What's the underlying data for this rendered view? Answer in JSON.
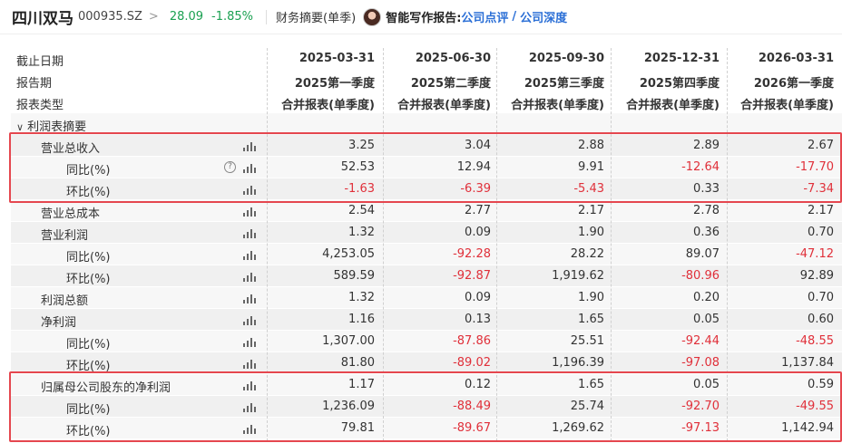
{
  "topbar": {
    "stock_name": "四川双马",
    "stock_code": "000935.SZ",
    "chevron": ">",
    "price": "28.09",
    "change": "-1.85%",
    "summary": "财务摘要(单季)",
    "ai_label": "智能写作报告:",
    "link_review": "公司点评",
    "slash": "/",
    "link_deep": "公司深度"
  },
  "header": {
    "rows": [
      {
        "label": "截止日期",
        "values": [
          "2025-03-31",
          "2025-06-30",
          "2025-09-30",
          "2025-12-31",
          "2026-03-31"
        ]
      },
      {
        "label": "报告期",
        "values": [
          "2025第一季度",
          "2025第二季度",
          "2025第三季度",
          "2025第四季度",
          "2026第一季度"
        ]
      },
      {
        "label": "报表类型",
        "values": [
          "合并报表(单季度)",
          "合并报表(单季度)",
          "合并报表(单季度)",
          "合并报表(单季度)",
          "合并报表(单季度)"
        ]
      }
    ]
  },
  "section": {
    "label": "利润表摘要",
    "chevron": "∨"
  },
  "rows": [
    {
      "label": "营业总收入",
      "indent": 1,
      "values": [
        "3.25",
        "3.04",
        "2.88",
        "2.89",
        "2.67"
      ],
      "neg": [
        false,
        false,
        false,
        false,
        false
      ]
    },
    {
      "label": "同比(%)",
      "indent": 2,
      "help": "?",
      "values": [
        "52.53",
        "12.94",
        "9.91",
        "-12.64",
        "-17.70"
      ],
      "neg": [
        false,
        false,
        false,
        true,
        true
      ]
    },
    {
      "label": "环比(%)",
      "indent": 2,
      "values": [
        "-1.63",
        "-6.39",
        "-5.43",
        "0.33",
        "-7.34"
      ],
      "neg": [
        true,
        true,
        true,
        false,
        true
      ]
    },
    {
      "label": "营业总成本",
      "indent": 1,
      "values": [
        "2.54",
        "2.77",
        "2.17",
        "2.78",
        "2.17"
      ],
      "neg": [
        false,
        false,
        false,
        false,
        false
      ]
    },
    {
      "label": "营业利润",
      "indent": 1,
      "values": [
        "1.32",
        "0.09",
        "1.90",
        "0.36",
        "0.70"
      ],
      "neg": [
        false,
        false,
        false,
        false,
        false
      ]
    },
    {
      "label": "同比(%)",
      "indent": 2,
      "values": [
        "4,253.05",
        "-92.28",
        "28.22",
        "89.07",
        "-47.12"
      ],
      "neg": [
        false,
        true,
        false,
        false,
        true
      ]
    },
    {
      "label": "环比(%)",
      "indent": 2,
      "values": [
        "589.59",
        "-92.87",
        "1,919.62",
        "-80.96",
        "92.89"
      ],
      "neg": [
        false,
        true,
        false,
        true,
        false
      ]
    },
    {
      "label": "利润总额",
      "indent": 1,
      "values": [
        "1.32",
        "0.09",
        "1.90",
        "0.20",
        "0.70"
      ],
      "neg": [
        false,
        false,
        false,
        false,
        false
      ]
    },
    {
      "label": "净利润",
      "indent": 1,
      "values": [
        "1.16",
        "0.13",
        "1.65",
        "0.05",
        "0.60"
      ],
      "neg": [
        false,
        false,
        false,
        false,
        false
      ]
    },
    {
      "label": "同比(%)",
      "indent": 2,
      "values": [
        "1,307.00",
        "-87.86",
        "25.51",
        "-92.44",
        "-48.55"
      ],
      "neg": [
        false,
        true,
        false,
        true,
        true
      ]
    },
    {
      "label": "环比(%)",
      "indent": 2,
      "values": [
        "81.80",
        "-89.02",
        "1,196.39",
        "-97.08",
        "1,137.84"
      ],
      "neg": [
        false,
        true,
        false,
        true,
        false
      ]
    },
    {
      "label": "归属母公司股东的净利润",
      "indent": 1,
      "values": [
        "1.17",
        "0.12",
        "1.65",
        "0.05",
        "0.59"
      ],
      "neg": [
        false,
        false,
        false,
        false,
        false
      ]
    },
    {
      "label": "同比(%)",
      "indent": 2,
      "values": [
        "1,236.09",
        "-88.49",
        "25.74",
        "-92.70",
        "-49.55"
      ],
      "neg": [
        false,
        true,
        false,
        true,
        true
      ]
    },
    {
      "label": "环比(%)",
      "indent": 2,
      "values": [
        "79.81",
        "-89.67",
        "1,269.62",
        "-97.13",
        "1,142.94"
      ],
      "neg": [
        false,
        true,
        false,
        true,
        false
      ]
    }
  ],
  "colors": {
    "negative": "#e0303a",
    "positive_change": "#1aa051",
    "link": "#2b6fd6",
    "highlight": "#e5474f"
  }
}
